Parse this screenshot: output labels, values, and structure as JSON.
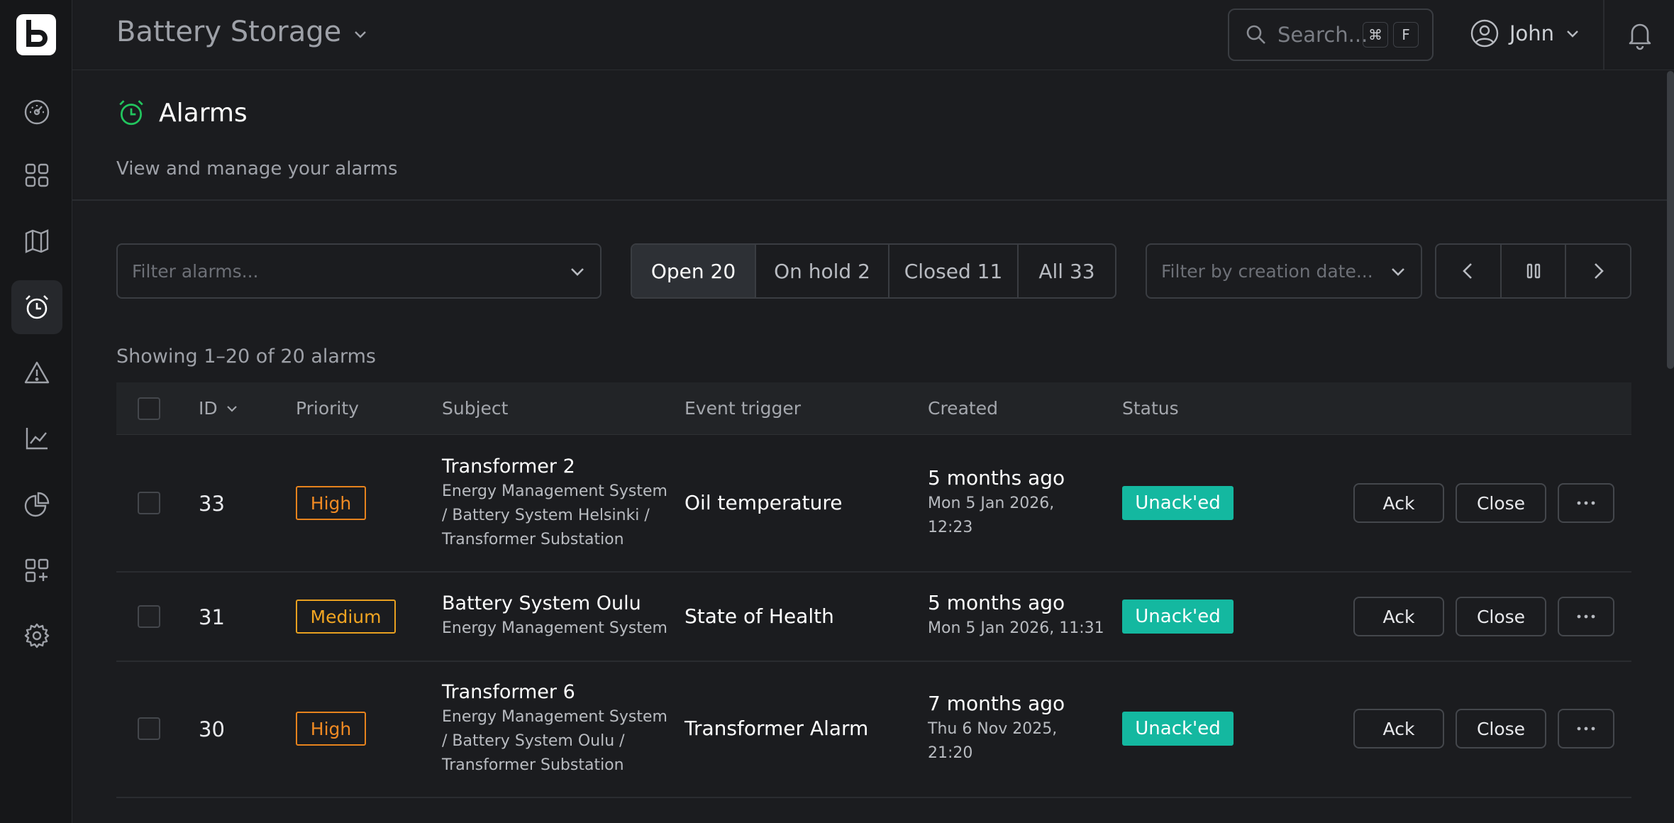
{
  "header": {
    "app_title": "Battery Storage",
    "search_placeholder": "Search...",
    "shortcut_keys": [
      "⌘",
      "F"
    ],
    "user_name": "John"
  },
  "sidebar": {
    "items": [
      {
        "icon": "dashboard-gauge-icon"
      },
      {
        "icon": "grid-icon"
      },
      {
        "icon": "map-icon"
      },
      {
        "icon": "alarm-clock-icon",
        "active": true
      },
      {
        "icon": "warning-icon"
      },
      {
        "icon": "chart-line-icon"
      },
      {
        "icon": "pie-chart-icon"
      },
      {
        "icon": "add-widget-icon"
      },
      {
        "icon": "gear-icon"
      }
    ]
  },
  "page": {
    "title": "Alarms",
    "subtitle": "View and manage your alarms",
    "title_icon_color": "#22c55e"
  },
  "filters": {
    "alarm_filter_placeholder": "Filter alarms...",
    "date_filter_placeholder": "Filter by creation date...",
    "tabs": [
      {
        "label": "Open 20",
        "active": true
      },
      {
        "label": "On hold 2"
      },
      {
        "label": "Closed 11"
      },
      {
        "label": "All 33"
      }
    ]
  },
  "table": {
    "summary": "Showing 1–20 of 20 alarms",
    "columns": {
      "id": "ID",
      "priority": "Priority",
      "subject": "Subject",
      "event_trigger": "Event trigger",
      "created": "Created",
      "status": "Status"
    },
    "rows": [
      {
        "id": "33",
        "priority": "High",
        "subject_title": "Transformer 2",
        "subject_path": [
          "Energy Management System",
          "/ Battery System Helsinki /",
          "Transformer Substation"
        ],
        "trigger": "Oil temperature",
        "created_rel": "5 months ago",
        "created_abs": [
          "Mon 5 Jan 2026,",
          "12:23"
        ],
        "status": "Unack'ed"
      },
      {
        "id": "31",
        "priority": "Medium",
        "subject_title": "Battery System Oulu",
        "subject_path": [
          "Energy Management System"
        ],
        "trigger": "State of Health",
        "created_rel": "5 months ago",
        "created_abs": [
          "Mon 5 Jan 2026, 11:31"
        ],
        "status": "Unack'ed"
      },
      {
        "id": "30",
        "priority": "High",
        "subject_title": "Transformer 6",
        "subject_path": [
          "Energy Management System",
          "/ Battery System Oulu /",
          "Transformer Substation"
        ],
        "trigger": "Transformer Alarm",
        "created_rel": "7 months ago",
        "created_abs": [
          "Thu 6 Nov 2025,",
          "21:20"
        ],
        "status": "Unack'ed"
      }
    ],
    "actions": {
      "ack": "Ack",
      "close": "Close"
    }
  },
  "colors": {
    "status_badge": "#14b8a0",
    "priority_high": "#f08a23",
    "priority_medium": "#f1a522"
  }
}
